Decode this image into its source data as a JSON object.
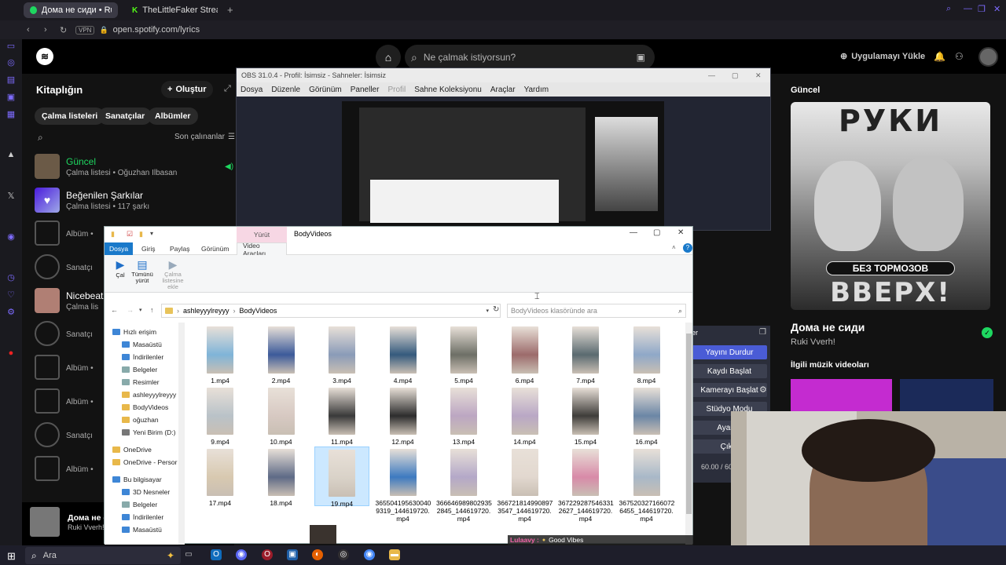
{
  "browser": {
    "tabs": [
      {
        "label": "Дома не сиди • Ruki",
        "icon": "spotify-icon"
      },
      {
        "label": "TheLittleFaker Stream - V",
        "icon": "kick-icon"
      }
    ],
    "vpn_label": "VPN",
    "url": "open.spotify.com/lyrics"
  },
  "spotify": {
    "search_placeholder": "Ne çalmak istiyorsun?",
    "install_label": "Uygulamayı Yükle",
    "library": {
      "title": "Kitaplığın",
      "create_label": "Oluştur",
      "chips": [
        "Çalma listeleri",
        "Sanatçılar",
        "Albümler"
      ],
      "sort_label": "Son çalınanlar",
      "items": [
        {
          "title": "Güncel",
          "sub": "Çalma listesi • Oğuzhan Ilbasan",
          "green": true
        },
        {
          "title": "Beğenilen Şarkılar",
          "sub": "Çalma listesi • 117 şarkı"
        },
        {
          "title": "",
          "sub": "Albüm •"
        },
        {
          "title": "",
          "sub": "Sanatçı"
        },
        {
          "title": "Nicebeatz",
          "sub": "Çalma lis"
        },
        {
          "title": "",
          "sub": "Sanatçı"
        },
        {
          "title": "",
          "sub": "Albüm •"
        },
        {
          "title": "",
          "sub": "Albüm •"
        },
        {
          "title": "",
          "sub": "Sanatçı"
        },
        {
          "title": "",
          "sub": "Albüm •"
        }
      ]
    },
    "right_panel": {
      "header": "Güncel",
      "cover_top": "РУКИ",
      "cover_mid": "БЕЗ ТОРМОЗОВ",
      "cover_bottom": "ВВЕРХ!",
      "song": "Дома не сиди",
      "artist": "Ruki Vverh!",
      "related": "İlgili müzik videoları"
    },
    "now_playing": {
      "song": "Дома не си",
      "artist": "Ruki Vverh!"
    }
  },
  "obs": {
    "title": "OBS 31.0.4 - Profil: İsimsiz - Sahneler: İsimsiz",
    "menu": [
      "Dosya",
      "Düzenle",
      "Görünüm",
      "Paneller",
      "Profil",
      "Sahne Koleksiyonu",
      "Araçlar",
      "Yardım"
    ],
    "controls": [
      "Yayını Durdur",
      "Kaydı Başlat",
      "Kamerayı Başlat",
      "Stüdyo Modu",
      "Ayarlar",
      "Çıkış"
    ],
    "controls_header": "er",
    "fps": "60.00 / 60."
  },
  "explorer": {
    "title": "BodyVideos",
    "manage_tab": "Yürüt",
    "tabs": [
      "Dosya",
      "Giriş",
      "Paylaş",
      "Görünüm",
      "Video Araçları"
    ],
    "ribbon": [
      "Çal",
      "Tümünü yürüt",
      "Çalma listesine ekle"
    ],
    "breadcrumb": [
      "ashleyyylreyyy",
      "BodyVideos"
    ],
    "search_placeholder": "BodyVideos klasöründe ara",
    "nav": [
      {
        "label": "Hızlı erişim",
        "kind": "star",
        "indent": 0
      },
      {
        "label": "Masaüstü",
        "kind": "blue",
        "indent": 1
      },
      {
        "label": "İndirilenler",
        "kind": "blue",
        "indent": 1
      },
      {
        "label": "Belgeler",
        "kind": "doc",
        "indent": 1
      },
      {
        "label": "Resimler",
        "kind": "doc",
        "indent": 1
      },
      {
        "label": "ashleyyylreyyy",
        "kind": "folder",
        "indent": 1
      },
      {
        "label": "BodyVideos",
        "kind": "folder",
        "indent": 1
      },
      {
        "label": "oğuzhan",
        "kind": "folder",
        "indent": 1
      },
      {
        "label": "Yeni Birim (D:)",
        "kind": "drive",
        "indent": 1
      },
      {
        "label": "OneDrive",
        "kind": "folder",
        "indent": 0
      },
      {
        "label": "OneDrive - Persor",
        "kind": "folder",
        "indent": 0
      },
      {
        "label": "Bu bilgisayar",
        "kind": "pc",
        "indent": 0
      },
      {
        "label": "3D Nesneler",
        "kind": "blue",
        "indent": 1
      },
      {
        "label": "Belgeler",
        "kind": "doc",
        "indent": 1
      },
      {
        "label": "İndirilenler",
        "kind": "blue",
        "indent": 1
      },
      {
        "label": "Masaüstü",
        "kind": "blue",
        "indent": 1
      }
    ],
    "files": [
      "1.mp4",
      "2.mp4",
      "3.mp4",
      "4.mp4",
      "5.mp4",
      "6.mp4",
      "7.mp4",
      "8.mp4",
      "9.mp4",
      "10.mp4",
      "11.mp4",
      "12.mp4",
      "13.mp4",
      "14.mp4",
      "15.mp4",
      "16.mp4",
      "17.mp4",
      "18.mp4",
      "19.mp4",
      "365504195630040 9319_144619720. mp4",
      "366646989802935 2845_144619720. mp4",
      "366721814990897 3547_144619720. mp4",
      "367229287546331 2627_144619720. mp4",
      "367520327166072 6455_144619720. mp4"
    ],
    "selected_index": 18
  },
  "chat": [
    {
      "user": "Lulaavy :",
      "msg": "Good Vibes"
    },
    {
      "user": "Lulaavy :",
      "msg": ""
    },
    {
      "user": "Lulaavy :",
      "msg": ""
    }
  ],
  "taskbar": {
    "search_label": "Ara"
  }
}
